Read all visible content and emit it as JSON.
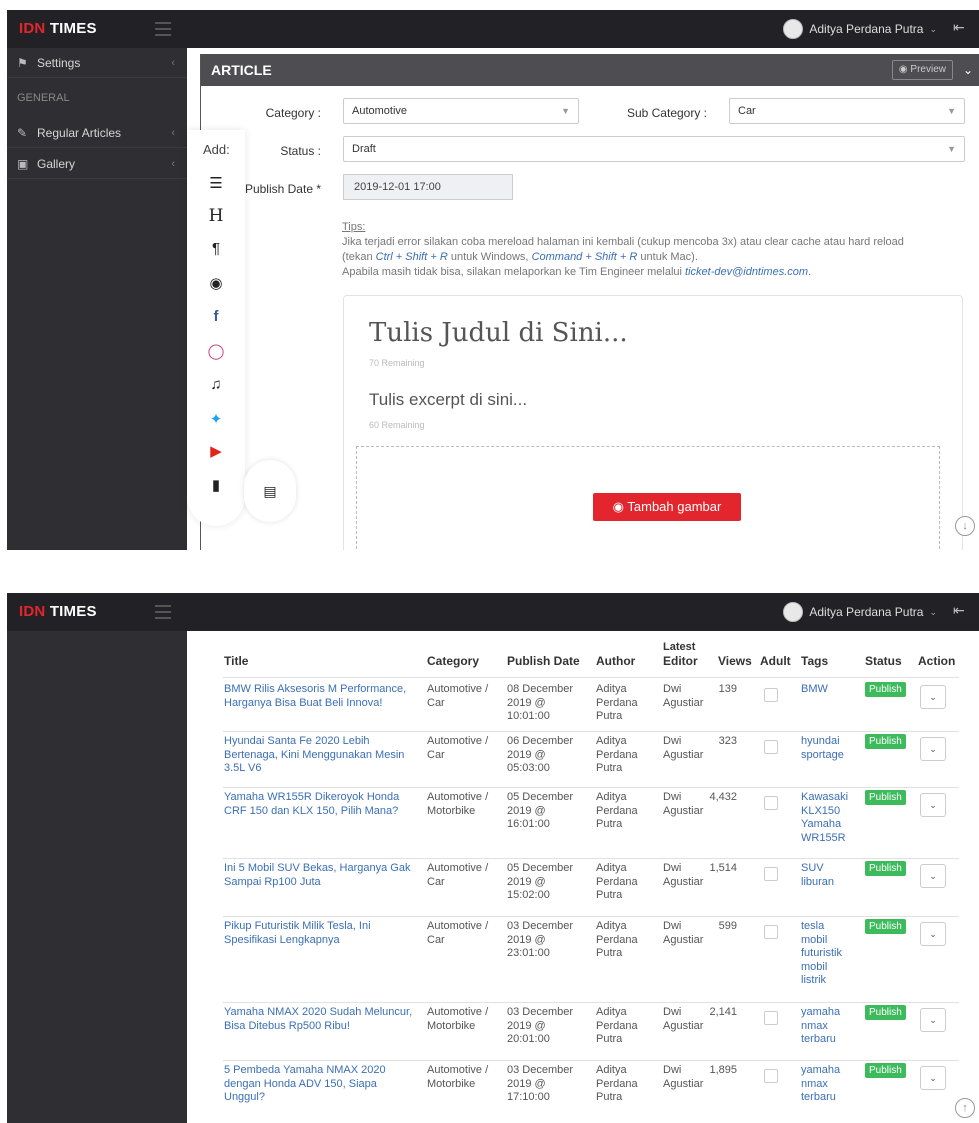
{
  "header": {
    "brand_idn": "IDN",
    "brand_times": "TIMES",
    "user_name": "Aditya Perdana Putra"
  },
  "sidebar": {
    "items": [
      {
        "label": "Settings",
        "icon": "flag-icon"
      },
      {
        "label": "Regular Articles",
        "icon": "pencil-icon"
      },
      {
        "label": "Gallery",
        "icon": "image-icon"
      }
    ],
    "section_label": "GENERAL"
  },
  "article": {
    "header_title": "ARTICLE",
    "preview_label": "Preview",
    "category_label": "Category :",
    "category_value": "Automotive",
    "subcategory_label": "Sub Category :",
    "subcategory_value": "Car",
    "status_label": "Status :",
    "status_value": "Draft",
    "publish_date_label": "Publish Date *",
    "publish_date_value": "2019-12-01 17:00",
    "tips_head": "Tips:",
    "tips_line1": "Jika terjadi error silakan coba mereload halaman ini kembali (cukup mencoba 3x) atau clear cache atau hard reload",
    "tips_line2_a": "(tekan",
    "tips_key1": "Ctrl + Shift + R",
    "tips_line2_b": "untuk Windows,",
    "tips_key2": "Command + Shift + R",
    "tips_line2_c": "untuk Mac).",
    "tips_line3": "Apabila masih tidak bisa, silakan melaporkan ke Tim Engineer melalui",
    "tips_email": "ticket-dev@idntimes.com",
    "title_placeholder": "Tulis Judul di Sini...",
    "title_remaining": "70 Remaining",
    "excerpt_placeholder": "Tulis excerpt di sini...",
    "excerpt_remaining": "60 Remaining",
    "add_image_label": "Tambah gambar",
    "toolbox_add_label": "Add:"
  },
  "table": {
    "headers": {
      "title": "Title",
      "category": "Category",
      "publish_date": "Publish Date",
      "author": "Author",
      "latest": "Latest",
      "editor": "Editor",
      "views": "Views",
      "adult": "Adult",
      "tags": "Tags",
      "status": "Status",
      "action": "Action"
    },
    "rows": [
      {
        "title": "BMW Rilis Aksesoris M Performance, Harganya Bisa Buat Beli Innova!",
        "cat1": "Automotive /",
        "cat2": "Car",
        "d1": "08 December",
        "d2": "2019 @",
        "d3": "10:01:00",
        "a1": "Aditya",
        "a2": "Perdana",
        "a3": "Putra",
        "e1": "Dwi",
        "e2": "Agustiar",
        "views": "139",
        "tags": "BMW",
        "status": "Publish"
      },
      {
        "title": "Hyundai Santa Fe 2020 Lebih Bertenaga, Kini Menggunakan Mesin 3.5L V6",
        "cat1": "Automotive /",
        "cat2": "Car",
        "d1": "06 December",
        "d2": "2019 @",
        "d3": "05:03:00",
        "a1": "Aditya",
        "a2": "Perdana",
        "a3": "Putra",
        "e1": "Dwi",
        "e2": "Agustiar",
        "views": "323",
        "tags": "hyundai sportage",
        "status": "Publish"
      },
      {
        "title": "Yamaha WR155R Dikeroyok Honda CRF 150 dan KLX 150, Pilih Mana?",
        "cat1": "Automotive /",
        "cat2": "Motorbike",
        "d1": "05 December",
        "d2": "2019 @",
        "d3": "16:01:00",
        "a1": "Aditya",
        "a2": "Perdana",
        "a3": "Putra",
        "e1": "Dwi",
        "e2": "Agustiar",
        "views": "4,432",
        "tags": "Kawasaki KLX150 Yamaha WR155R",
        "status": "Publish"
      },
      {
        "title": "Ini 5 Mobil SUV Bekas, Harganya Gak Sampai Rp100 Juta",
        "cat1": "Automotive /",
        "cat2": "Car",
        "d1": "05 December",
        "d2": "2019 @",
        "d3": "15:02:00",
        "a1": "Aditya",
        "a2": "Perdana",
        "a3": "Putra",
        "e1": "Dwi",
        "e2": "Agustiar",
        "views": "1,514",
        "tags": "SUV liburan",
        "status": "Publish"
      },
      {
        "title": "Pikup Futuristik Milik Tesla, Ini Spesifikasi Lengkapnya",
        "cat1": "Automotive /",
        "cat2": "Car",
        "d1": "03 December",
        "d2": "2019 @",
        "d3": "23:01:00",
        "a1": "Aditya",
        "a2": "Perdana",
        "a3": "Putra",
        "e1": "Dwi",
        "e2": "Agustiar",
        "views": "599",
        "tags": "tesla mobil futuristik mobil listrik",
        "status": "Publish"
      },
      {
        "title": "Yamaha NMAX 2020 Sudah Meluncur, Bisa Ditebus Rp500 Ribu!",
        "cat1": "Automotive /",
        "cat2": "Motorbike",
        "d1": "03 December",
        "d2": "2019 @",
        "d3": "20:01:00",
        "a1": "Aditya",
        "a2": "Perdana",
        "a3": "Putra",
        "e1": "Dwi",
        "e2": "Agustiar",
        "views": "2,141",
        "tags": "yamaha nmax terbaru",
        "status": "Publish"
      },
      {
        "title": "5 Pembeda Yamaha NMAX 2020 dengan Honda ADV 150, Siapa Unggul?",
        "cat1": "Automotive /",
        "cat2": "Motorbike",
        "d1": "03 December",
        "d2": "2019 @",
        "d3": "17:10:00",
        "a1": "Aditya",
        "a2": "Perdana",
        "a3": "Putra",
        "e1": "Dwi",
        "e2": "Agustiar",
        "views": "1,895",
        "tags": "yamaha nmax terbaru",
        "status": "Publish"
      }
    ]
  }
}
